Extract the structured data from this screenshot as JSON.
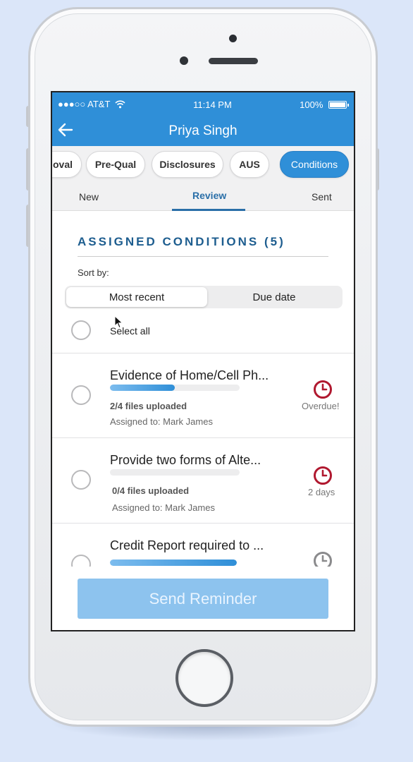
{
  "status_bar": {
    "carrier": "●●●○○ AT&T",
    "wifi_icon": "wifi-icon",
    "time": "11:14 PM",
    "battery": "100%"
  },
  "nav": {
    "back_icon": "arrow-left-icon",
    "title": "Priya Singh"
  },
  "chips": [
    {
      "label": "oval",
      "active": false
    },
    {
      "label": "Pre-Qual",
      "active": false
    },
    {
      "label": "Disclosures",
      "active": false
    },
    {
      "label": "AUS",
      "active": false
    },
    {
      "label": "Conditions",
      "active": true
    }
  ],
  "tabs": [
    {
      "label": "New"
    },
    {
      "label": "Review",
      "active": true
    },
    {
      "label": "Sent"
    }
  ],
  "section": {
    "title": "ASSIGNED CONDITIONS (5)",
    "sort_label": "Sort by:",
    "sort_options": [
      "Most recent",
      "Due date"
    ],
    "sort_selected": "Most recent",
    "select_all": "Select all"
  },
  "conditions": [
    {
      "title": "Evidence of Home/Cell Ph...",
      "progress": 0.5,
      "files": "2/4 files uploaded",
      "assigned": "Assigned to: Mark James",
      "due": "Overdue!",
      "clock_color": "#b0182f"
    },
    {
      "title": "Provide two forms of Alte...",
      "progress": 0,
      "files": "0/4 files uploaded",
      "assigned": "Assigned to: Mark James",
      "due": "2 days",
      "clock_color": "#b0182f"
    },
    {
      "title": "Credit Report required to ...",
      "progress": 1,
      "clock_color": "#8a8a8c"
    }
  ],
  "send_button": "Send Reminder",
  "colors": {
    "primary": "#2f8fd8",
    "heading": "#1d5d8f",
    "alert": "#b0182f",
    "button_disabled": "#8dc3ee"
  }
}
